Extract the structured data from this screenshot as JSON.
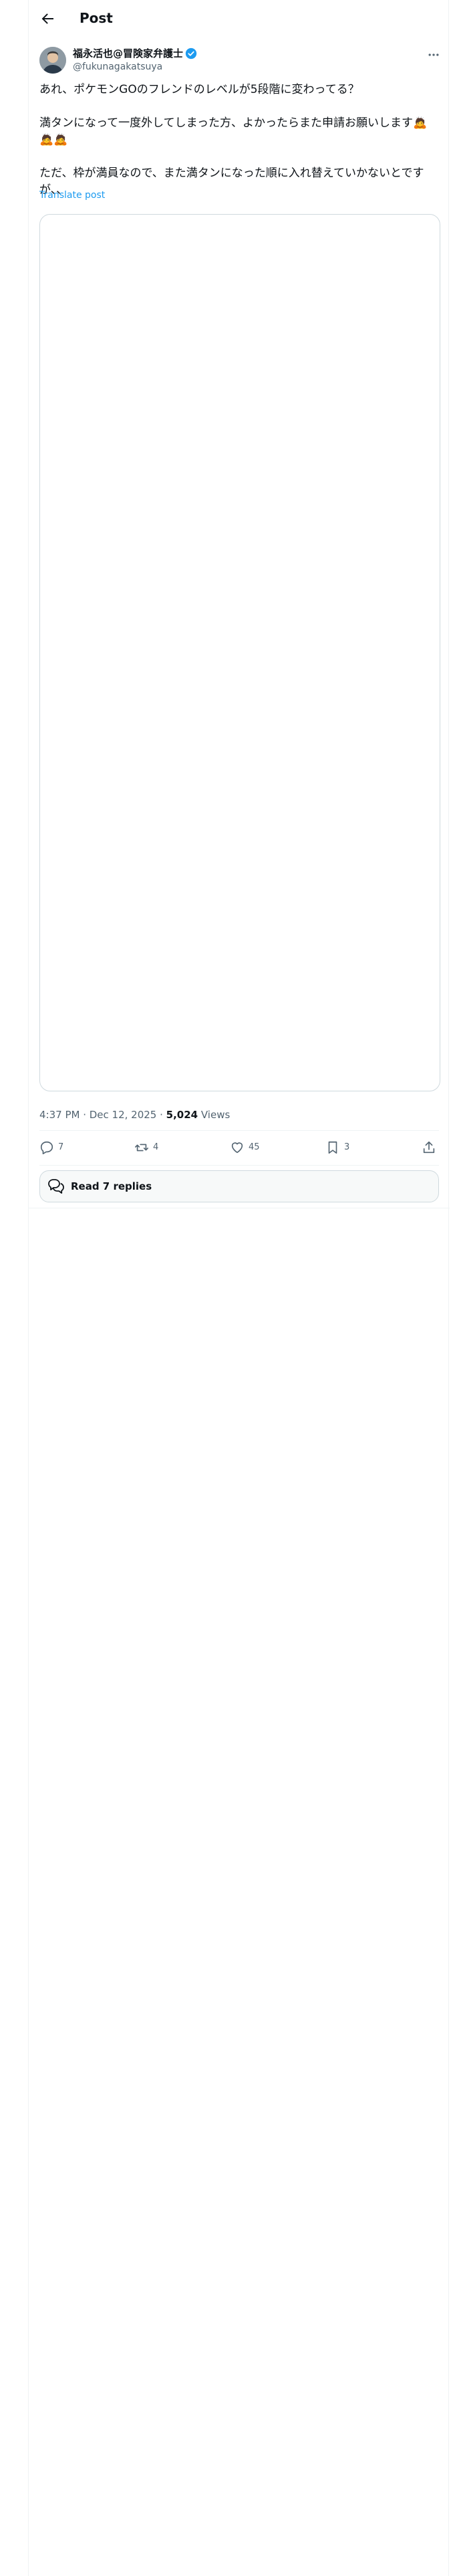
{
  "header": {
    "title": "Post"
  },
  "tweet": {
    "author_name": "福永活也@冒険家弁護士",
    "author_handle": "@fukunagakatsuya",
    "text": "あれ、ポケモンGOのフレンドのレベルが5段階に変わってる？\n\n満タンになって一度外してしまった方、よかったらまた申請お願いします🙇🙇🙇\n\nただ、枠が満員なので、また満タンになった順に入れ替えていかないとですが、、",
    "translate_label": "Translate post",
    "time": "4:37 PM · Dec 12, 2025 · ",
    "views_count": "5,024",
    "views_label": " Views",
    "stats": {
      "replies": "7",
      "reposts": "4",
      "likes": "45",
      "bookmarks": "3"
    },
    "read_replies_label": "Read 7 replies"
  },
  "colors": {
    "accent": "#1d9bf0",
    "muted": "#536471",
    "border": "#cfd9de"
  },
  "icons": [
    "back-arrow-icon",
    "verified-badge-icon",
    "more-icon",
    "reply-icon",
    "repost-icon",
    "like-icon",
    "bookmark-icon",
    "share-icon",
    "replies-bubble-icon"
  ]
}
